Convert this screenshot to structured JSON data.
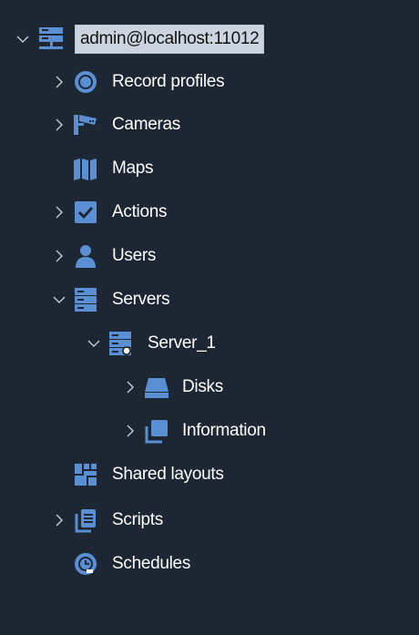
{
  "tree": {
    "root": {
      "label": "admin@localhost:11012",
      "expanded": true,
      "selected": true,
      "icon": "server-cluster-icon"
    },
    "items": [
      {
        "label": "Record profiles",
        "icon": "record-icon",
        "expandable": true,
        "expanded": false
      },
      {
        "label": "Cameras",
        "icon": "camera-icon",
        "expandable": true,
        "expanded": false
      },
      {
        "label": "Maps",
        "icon": "map-icon",
        "expandable": false
      },
      {
        "label": "Actions",
        "icon": "checkbox-icon",
        "expandable": true,
        "expanded": false
      },
      {
        "label": "Users",
        "icon": "user-icon",
        "expandable": true,
        "expanded": false
      },
      {
        "label": "Servers",
        "icon": "servers-icon",
        "expandable": true,
        "expanded": true
      },
      {
        "label": "Server_1",
        "icon": "server-icon",
        "expandable": true,
        "expanded": true
      },
      {
        "label": "Disks",
        "icon": "disk-icon",
        "expandable": true,
        "expanded": false
      },
      {
        "label": "Information",
        "icon": "information-icon",
        "expandable": true,
        "expanded": false
      },
      {
        "label": "Shared layouts",
        "icon": "layout-icon",
        "expandable": false
      },
      {
        "label": "Scripts",
        "icon": "scripts-icon",
        "expandable": true,
        "expanded": false
      },
      {
        "label": "Schedules",
        "icon": "schedule-icon",
        "expandable": false
      }
    ]
  },
  "colors": {
    "background": "#1c2733",
    "icon_blue": "#5b8fd4",
    "text": "#ffffff",
    "selection_bg": "#ccd5df",
    "selection_text": "#111111",
    "chevron": "#c8ced6"
  }
}
